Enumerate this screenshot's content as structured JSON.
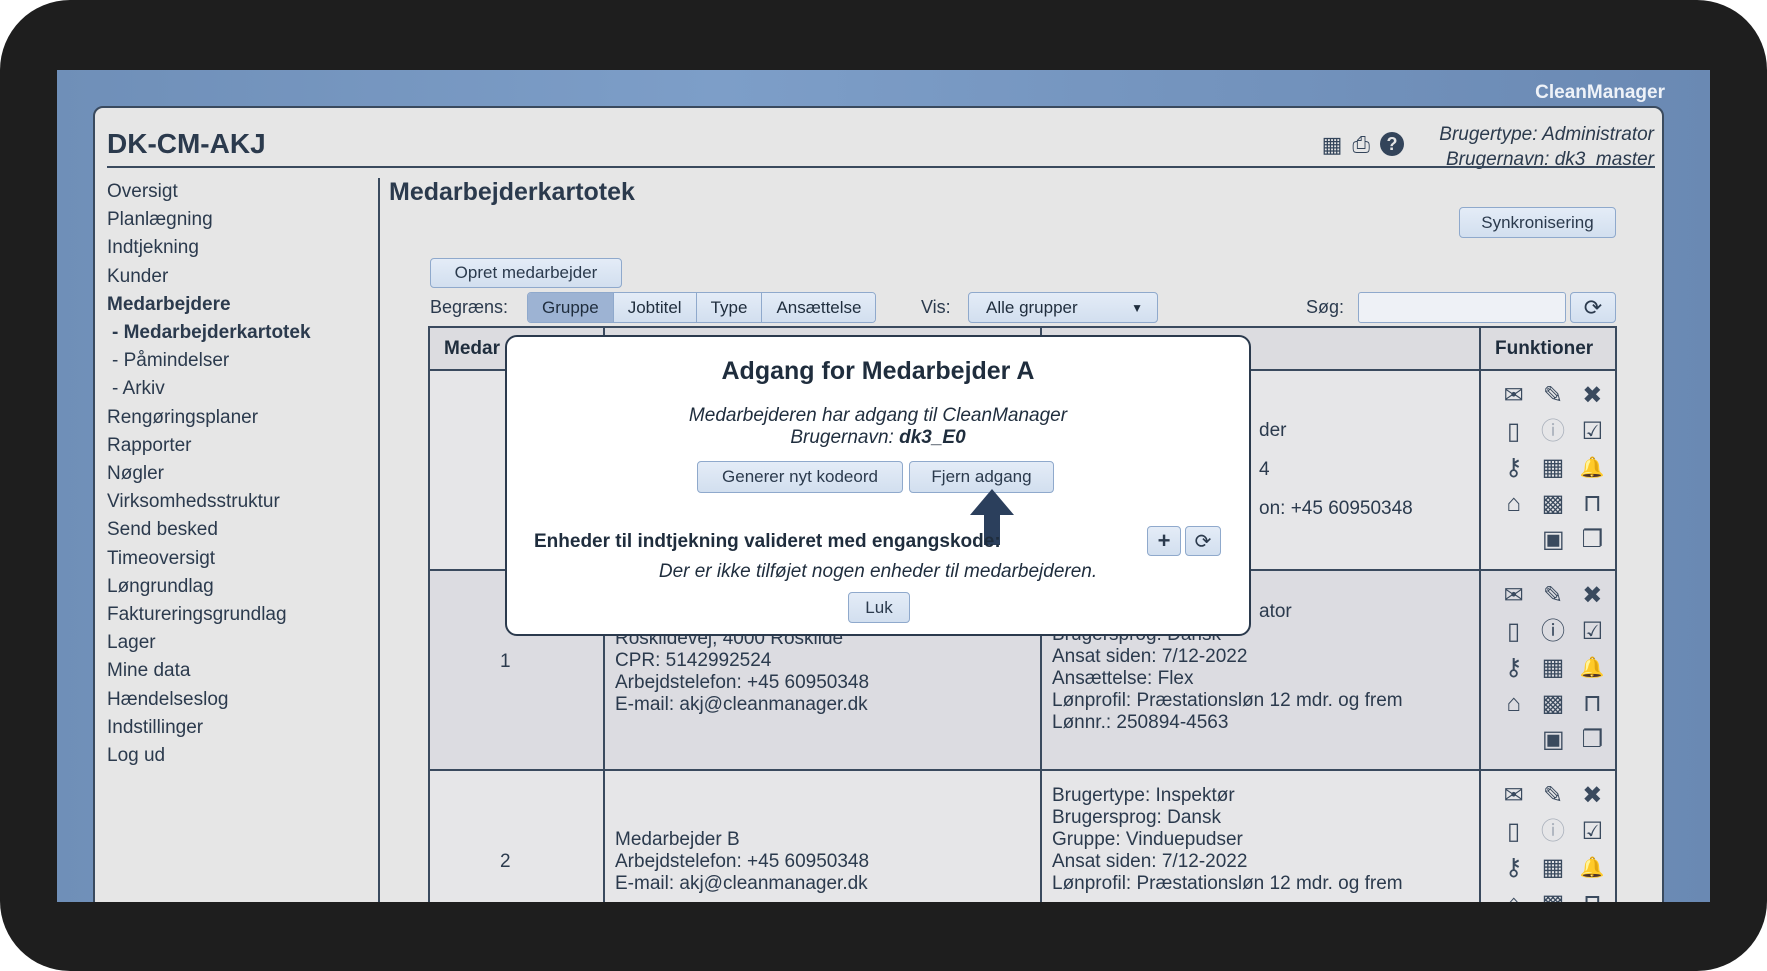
{
  "app": {
    "brand": "CleanManager",
    "title": "DK-CM-AKJ"
  },
  "header": {
    "icons": [
      "table-icon",
      "print-icon",
      "help-icon"
    ],
    "user_type": "Brugertype: Administrator",
    "user_name": "Brugernavn: dk3_master"
  },
  "sidebar": {
    "items": [
      {
        "label": "Oversigt"
      },
      {
        "label": "Planlægning"
      },
      {
        "label": "Indtjekning"
      },
      {
        "label": "Kunder"
      },
      {
        "label": "Medarbejdere",
        "active": true
      },
      {
        "label": "- Medarbejderkartotek",
        "active": true
      },
      {
        "label": "- Påmindelser"
      },
      {
        "label": "- Arkiv"
      },
      {
        "label": "Rengøringsplaner"
      },
      {
        "label": "Rapporter"
      },
      {
        "label": "Nøgler"
      },
      {
        "label": "Virksomhedsstruktur"
      },
      {
        "label": "Send besked"
      },
      {
        "label": "Timeoversigt"
      },
      {
        "label": "Løngrundlag"
      },
      {
        "label": "Faktureringsgrundlag"
      },
      {
        "label": "Lager"
      },
      {
        "label": "Mine data"
      },
      {
        "label": "Hændelseslog"
      },
      {
        "label": "Indstillinger"
      },
      {
        "label": "Log ud"
      }
    ]
  },
  "main": {
    "page_title": "Medarbejderkartotek",
    "sync_label": "Synkronisering",
    "create_label": "Opret medarbejder",
    "filter_label": "Begræns:",
    "filters": [
      "Gruppe",
      "Jobtitel",
      "Type",
      "Ansættelse"
    ],
    "active_filter": "Gruppe",
    "show_label": "Vis:",
    "show_value": "Alle grupper",
    "search_label": "Søg:",
    "search_value": "",
    "table": {
      "headers": {
        "col1": "Medar",
        "functions": "Funktioner"
      },
      "rows": [
        {
          "num": "",
          "col2": [],
          "col3_fragments": [
            "der",
            "4",
            "on: +45 60950348"
          ]
        },
        {
          "num": "1",
          "col2": [
            "Roskildevej, 4000 Roskilde",
            "CPR: 5142992524",
            "Arbejdstelefon: +45 60950348",
            "E-mail: akj@cleanmanager.dk"
          ],
          "col3_fragment": "ator",
          "col3": [
            "Brugersprog: Dansk",
            "Ansat siden: 7/12-2022",
            "Ansættelse: Flex",
            "Lønprofil: Præstationsløn 12 mdr. og frem",
            "Lønnr.: 250894-4563"
          ]
        },
        {
          "num": "2",
          "col2": [
            "Medarbejder B",
            "Arbejdstelefon: +45 60950348",
            "E-mail: akj@cleanmanager.dk"
          ],
          "col3": [
            "Brugertype: Inspektør",
            "Brugersprog: Dansk",
            "Gruppe: Vinduepudser",
            "Ansat siden: 7/12-2022",
            "Lønprofil: Præstationsløn 12 mdr. og frem"
          ]
        }
      ],
      "function_icons": [
        "mail-icon",
        "edit-icon",
        "delete-icon",
        "book-icon",
        "info-icon",
        "clipboard-check-icon",
        "key-icon",
        "calendar-icon",
        "bell-icon",
        "home-icon",
        "qr-code-icon",
        "unlock-icon",
        "contact-card-icon",
        "documents-icon"
      ]
    }
  },
  "dialog": {
    "title": "Adgang for Medarbejder A",
    "access_text": "Medarbejderen har adgang til CleanManager",
    "username_label": "Brugernavn: ",
    "username": "dk3_E0",
    "generate_label": "Generer nyt kodeord",
    "remove_label": "Fjern adgang",
    "devices_label": "Enheder til indtjekning valideret med engangskode:",
    "no_devices": "Der er ikke tilføjet nogen enheder til medarbejderen.",
    "close_label": "Luk",
    "arrow_color": "#2b3f5c"
  }
}
